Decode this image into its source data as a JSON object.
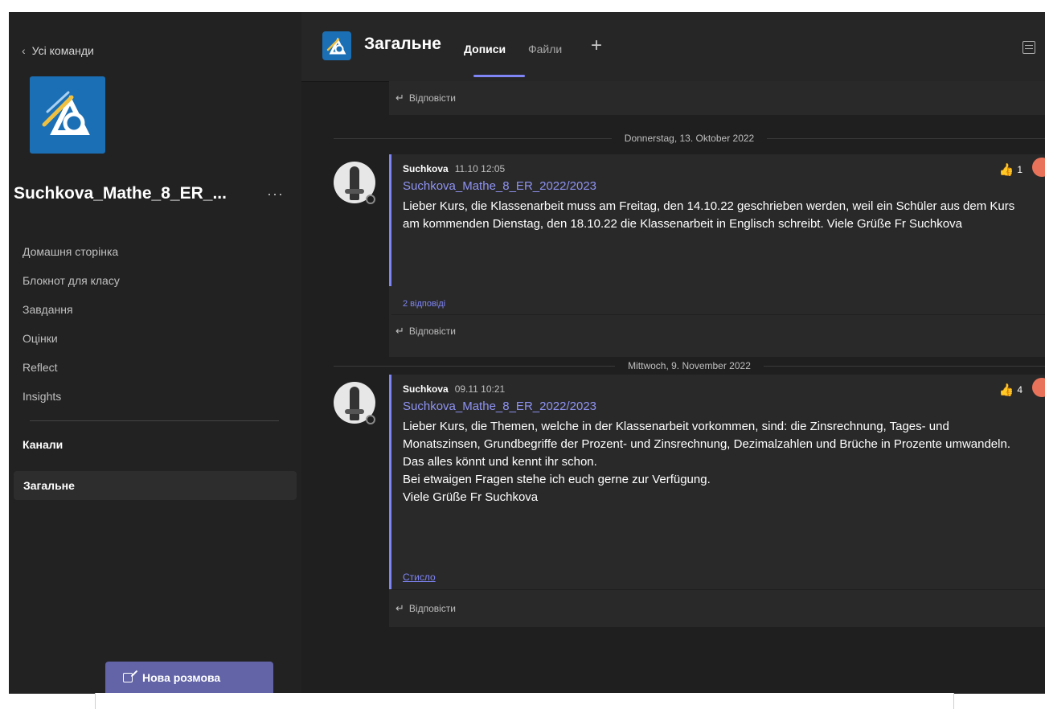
{
  "sidebar": {
    "back_label": "Усі команди",
    "team_name": "Suchkova_Mathe_8_ER_...",
    "more": "···",
    "nav_items": [
      {
        "label": "Домашня сторінка"
      },
      {
        "label": "Блокнот для класу"
      },
      {
        "label": "Завдання"
      },
      {
        "label": "Оцінки"
      },
      {
        "label": "Reflect"
      },
      {
        "label": "Insights"
      }
    ],
    "channels_header": "Канали",
    "channels": [
      {
        "label": "Загальне"
      }
    ]
  },
  "header": {
    "channel_title": "Загальне",
    "tabs": [
      {
        "label": "Дописи"
      },
      {
        "label": "Файли"
      }
    ],
    "add_tab": "+"
  },
  "feed": {
    "reply_label": "Відповісти",
    "date_1": "Donnerstag, 13. Oktober 2022",
    "date_2": "Mittwoch, 9. November 2022",
    "messages": [
      {
        "author": "Suchkova",
        "time": "11.10 12:05",
        "subject": "Suchkova_Mathe_8_ER_2022/2023",
        "body": [
          "Lieber Kurs, die Klassenarbeit muss am Freitag, den 14.10.22 geschrieben werden, weil ein Schüler aus dem Kurs am kommenden Dienstag, den 18.10.22 die Klassenarbeit in Englisch schreibt. Viele Grüße Fr Suchkova"
        ],
        "reaction_count": "1",
        "replies_link": "2 відповіді"
      },
      {
        "author": "Suchkova",
        "time": "09.11 10:21",
        "subject": "Suchkova_Mathe_8_ER_2022/2023",
        "body": [
          "Lieber Kurs, die Themen, welche in der Klassenarbeit vorkommen, sind: die Zinsrechnung, Tages- und Monatszinsen, Grundbegriffe der Prozent- und Zinsrechnung, Dezimalzahlen und Brüche in Prozente umwandeln.",
          "Das alles könnt und kennt ihr schon.",
          "Bei etwaigen Fragen stehe ich euch gerne zur Verfügung.",
          "Viele Grüße Fr Suchkova"
        ],
        "reaction_count": "4",
        "collapse_link": "Стисло"
      }
    ]
  },
  "new_conversation_label": "Нова розмова",
  "colors": {
    "accent": "#7f85f5",
    "button": "#6264a7",
    "team_tile": "#1b6fb5",
    "sidebar_bg": "#222222",
    "main_bg": "#1f1f1f",
    "card_bg": "#292929"
  }
}
